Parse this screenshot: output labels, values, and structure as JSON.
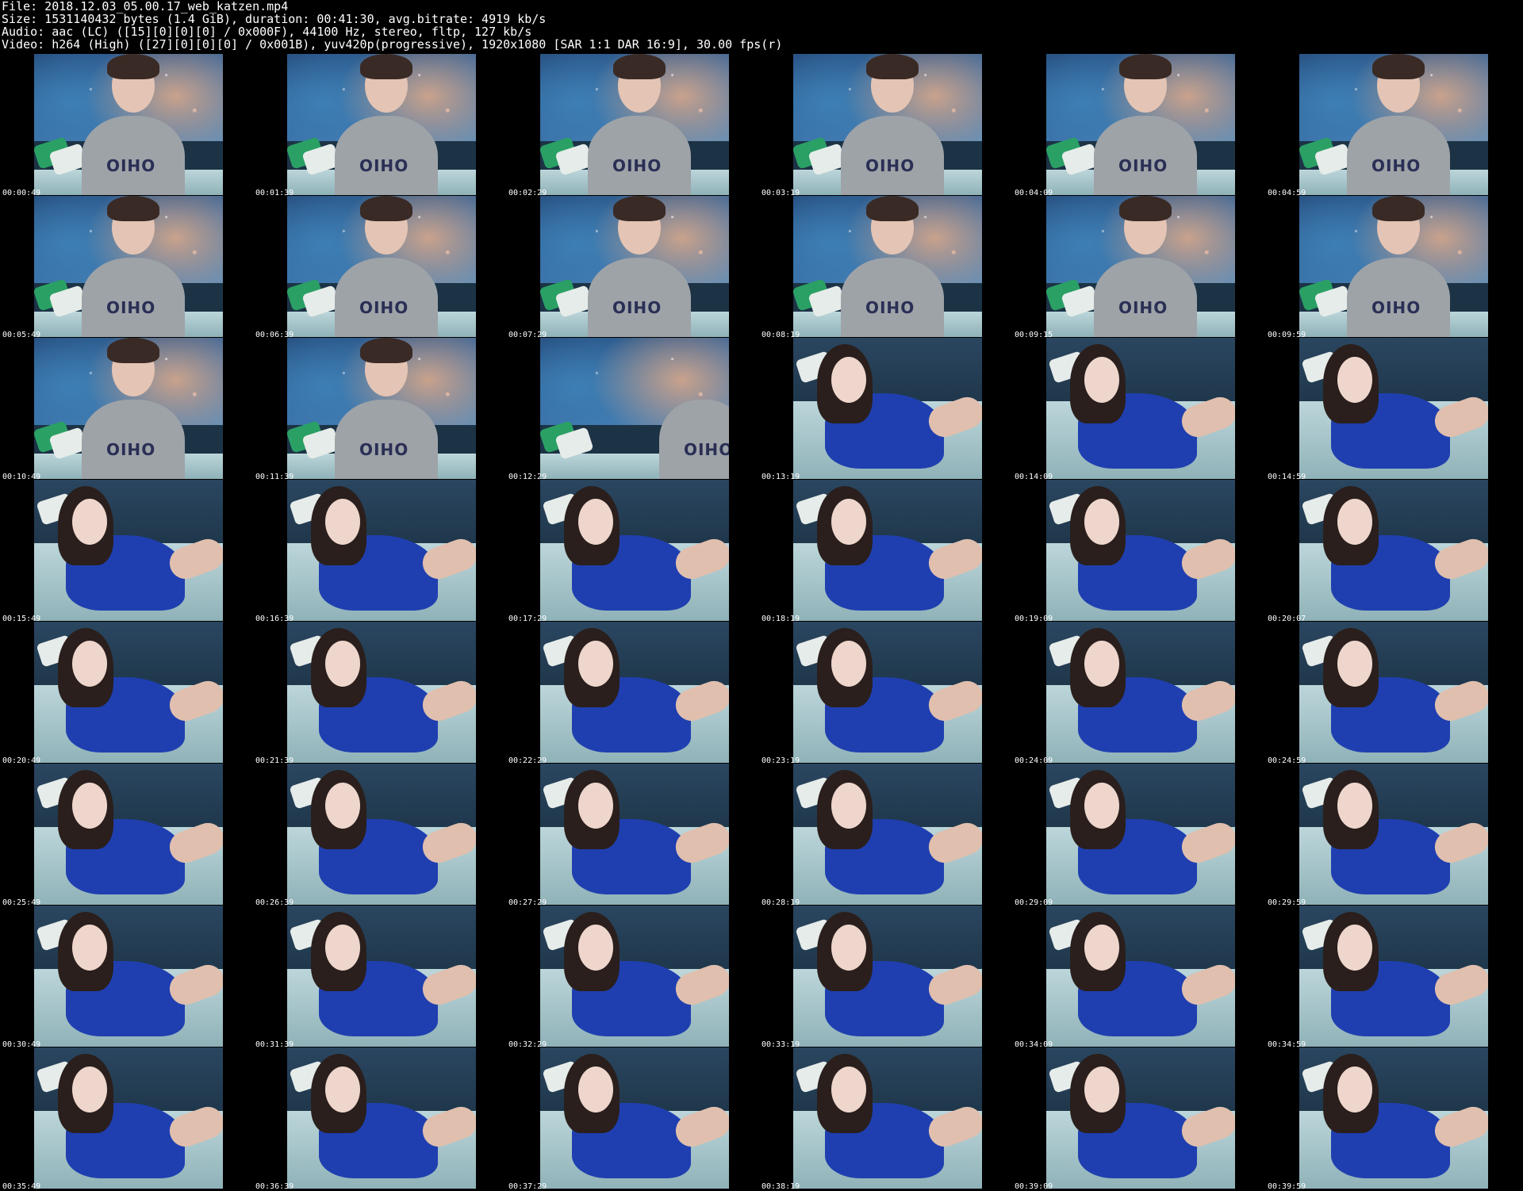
{
  "header": {
    "file": "File: 2018.12.03_05.00.17_web_katzen.mp4",
    "size": "Size: 1531140432 bytes (1.4 GiB), duration: 00:41:30, avg.bitrate: 4919 kb/s",
    "audio": "Audio: aac (LC) ([15][0][0][0] / 0x000F), 44100 Hz, stereo, fltp, 127 kb/s",
    "video": "Video: h264 (High) ([27][0][0][0] / 0x001B), yuv420p(progressive), 1920x1080 [SAR 1:1 DAR 16:9], 30.00 fps(r)"
  },
  "thumbnails": [
    {
      "time": "00:00:49",
      "scene": "male"
    },
    {
      "time": "00:01:39",
      "scene": "male"
    },
    {
      "time": "00:02:29",
      "scene": "male"
    },
    {
      "time": "00:03:19",
      "scene": "male"
    },
    {
      "time": "00:04:09",
      "scene": "male"
    },
    {
      "time": "00:04:59",
      "scene": "male"
    },
    {
      "time": "00:05:49",
      "scene": "male"
    },
    {
      "time": "00:06:39",
      "scene": "male"
    },
    {
      "time": "00:07:29",
      "scene": "male"
    },
    {
      "time": "00:08:19",
      "scene": "male"
    },
    {
      "time": "00:09:15",
      "scene": "male"
    },
    {
      "time": "00:09:59",
      "scene": "male"
    },
    {
      "time": "00:10:49",
      "scene": "male"
    },
    {
      "time": "00:11:39",
      "scene": "male"
    },
    {
      "time": "00:12:29",
      "scene": "male-edge"
    },
    {
      "time": "00:13:19",
      "scene": "female"
    },
    {
      "time": "00:14:09",
      "scene": "female"
    },
    {
      "time": "00:14:59",
      "scene": "female"
    },
    {
      "time": "00:15:49",
      "scene": "female"
    },
    {
      "time": "00:16:39",
      "scene": "female"
    },
    {
      "time": "00:17:29",
      "scene": "female"
    },
    {
      "time": "00:18:19",
      "scene": "female"
    },
    {
      "time": "00:19:09",
      "scene": "female"
    },
    {
      "time": "00:20:07",
      "scene": "female"
    },
    {
      "time": "00:20:49",
      "scene": "female"
    },
    {
      "time": "00:21:39",
      "scene": "female"
    },
    {
      "time": "00:22:29",
      "scene": "female"
    },
    {
      "time": "00:23:19",
      "scene": "female"
    },
    {
      "time": "00:24:09",
      "scene": "female"
    },
    {
      "time": "00:24:59",
      "scene": "female"
    },
    {
      "time": "00:25:49",
      "scene": "female"
    },
    {
      "time": "00:26:39",
      "scene": "female"
    },
    {
      "time": "00:27:29",
      "scene": "female"
    },
    {
      "time": "00:28:19",
      "scene": "female"
    },
    {
      "time": "00:29:09",
      "scene": "female"
    },
    {
      "time": "00:29:59",
      "scene": "female"
    },
    {
      "time": "00:30:49",
      "scene": "female"
    },
    {
      "time": "00:31:39",
      "scene": "female"
    },
    {
      "time": "00:32:29",
      "scene": "female"
    },
    {
      "time": "00:33:19",
      "scene": "female"
    },
    {
      "time": "00:34:09",
      "scene": "female"
    },
    {
      "time": "00:34:59",
      "scene": "female"
    },
    {
      "time": "00:35:49",
      "scene": "female"
    },
    {
      "time": "00:36:39",
      "scene": "female"
    },
    {
      "time": "00:37:29",
      "scene": "female"
    },
    {
      "time": "00:38:19",
      "scene": "female"
    },
    {
      "time": "00:39:09",
      "scene": "female"
    },
    {
      "time": "00:39:59",
      "scene": "female"
    }
  ],
  "shirt_text": "OHIO",
  "colors": {
    "background": "#000000",
    "text": "#ffffff",
    "shirt_gray": "#9ea3a8",
    "shirt_blue": "#1f3fb0",
    "hair_dark": "#2a1f1c"
  }
}
